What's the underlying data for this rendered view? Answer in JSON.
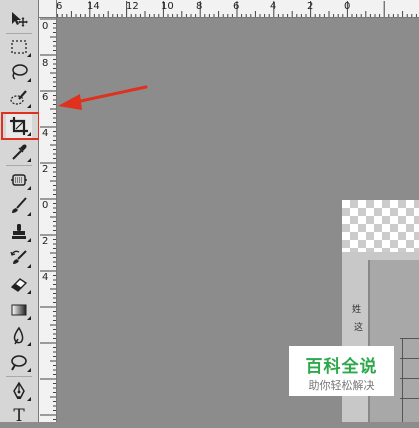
{
  "colors": {
    "toolbar_bg": "#d6d6d6",
    "workspace_bg": "#8c8c8c",
    "ruler_bg": "#f2f2f2",
    "highlight": "#e0301e",
    "watermark_green": "#2da84a"
  },
  "toolbar": {
    "tools": [
      {
        "icon": "move-icon"
      },
      {
        "icon": "marquee-icon"
      },
      {
        "icon": "lasso-icon"
      },
      {
        "icon": "quick-selection-icon"
      },
      {
        "icon": "crop-icon",
        "active": true
      },
      {
        "icon": "eyedropper-icon"
      },
      {
        "icon": "healing-brush-icon"
      },
      {
        "icon": "brush-icon"
      },
      {
        "icon": "clone-stamp-icon"
      },
      {
        "icon": "history-brush-icon"
      },
      {
        "icon": "eraser-icon"
      },
      {
        "icon": "gradient-icon"
      },
      {
        "icon": "blur-icon"
      },
      {
        "icon": "dodge-icon"
      },
      {
        "icon": "pen-icon"
      },
      {
        "icon": "type-icon"
      }
    ]
  },
  "ruler": {
    "horizontal": [
      "6",
      "14",
      "12",
      "10",
      "8",
      "6",
      "4",
      "2",
      "0"
    ],
    "vertical": [
      "0",
      "8",
      "6",
      "4",
      "2",
      "0",
      "2",
      "4"
    ]
  },
  "document": {
    "text_1": "姓",
    "text_2": "这"
  },
  "watermark": {
    "title": "百科全说",
    "subtitle": "助你轻松解决"
  },
  "type_tool_glyph": "T"
}
